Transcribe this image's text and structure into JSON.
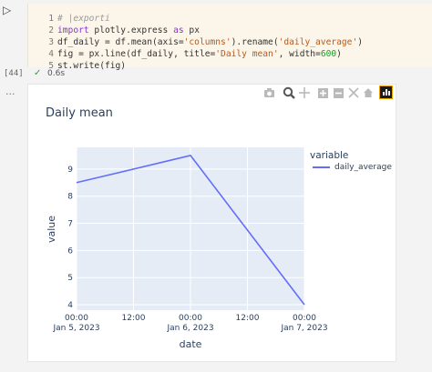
{
  "cell": {
    "run_icon": "play-icon",
    "lines": [
      {
        "n": "1",
        "parts": [
          {
            "c": "cm",
            "t": "# |exporti"
          }
        ]
      },
      {
        "n": "2",
        "parts": [
          {
            "c": "kw",
            "t": "import"
          },
          {
            "c": "",
            "t": " plotly.express "
          },
          {
            "c": "kw",
            "t": "as"
          },
          {
            "c": "",
            "t": " px"
          }
        ]
      },
      {
        "n": "3",
        "parts": [
          {
            "c": "",
            "t": "df_daily = df.mean(axis="
          },
          {
            "c": "str",
            "t": "'columns'"
          },
          {
            "c": "",
            "t": ").rename("
          },
          {
            "c": "str",
            "t": "'daily_average'"
          },
          {
            "c": "",
            "t": ")"
          }
        ]
      },
      {
        "n": "4",
        "parts": [
          {
            "c": "",
            "t": "fig = px.line(df_daily, title="
          },
          {
            "c": "str",
            "t": "'Daily mean'"
          },
          {
            "c": "",
            "t": ", width="
          },
          {
            "c": "num",
            "t": "600"
          },
          {
            "c": "",
            "t": ")"
          }
        ]
      },
      {
        "n": "5",
        "parts": [
          {
            "c": "",
            "t": "st.write(fig)"
          }
        ]
      }
    ],
    "execution_count": "[44]",
    "status_icon": "check-icon",
    "duration": "0.6s",
    "output_menu": "..."
  },
  "modebar": [
    "camera-icon",
    "zoom-icon",
    "pan-icon",
    "zoom-in-icon",
    "zoom-out-icon",
    "autoscale-icon",
    "reset-axes-icon",
    "streamlit-logo-icon"
  ],
  "colors": {
    "line": "#636efa",
    "plot_bg": "#e5ecf6",
    "text": "#2a3f5f"
  },
  "chart_data": {
    "type": "line",
    "title": "Daily mean",
    "xlabel": "date",
    "ylabel": "value",
    "x": [
      "2023-01-05 00:00",
      "2023-01-06 00:00",
      "2023-01-07 00:00"
    ],
    "series": [
      {
        "name": "daily_average",
        "values": [
          8.5,
          9.5,
          4.0
        ]
      }
    ],
    "xlim": [
      "2023-01-05 00:00",
      "2023-01-07 00:00"
    ],
    "ylim": [
      3.8,
      9.8
    ],
    "xticks": [
      {
        "value": "2023-01-05 00:00",
        "label": "00:00",
        "sub": "Jan 5, 2023"
      },
      {
        "value": "2023-01-05 12:00",
        "label": "12:00",
        "sub": ""
      },
      {
        "value": "2023-01-06 00:00",
        "label": "00:00",
        "sub": "Jan 6, 2023"
      },
      {
        "value": "2023-01-06 12:00",
        "label": "12:00",
        "sub": ""
      },
      {
        "value": "2023-01-07 00:00",
        "label": "00:00",
        "sub": "Jan 7, 2023"
      }
    ],
    "yticks": [
      4,
      5,
      6,
      7,
      8,
      9
    ],
    "legend_title": "variable",
    "legend_position": "right",
    "grid": true
  }
}
